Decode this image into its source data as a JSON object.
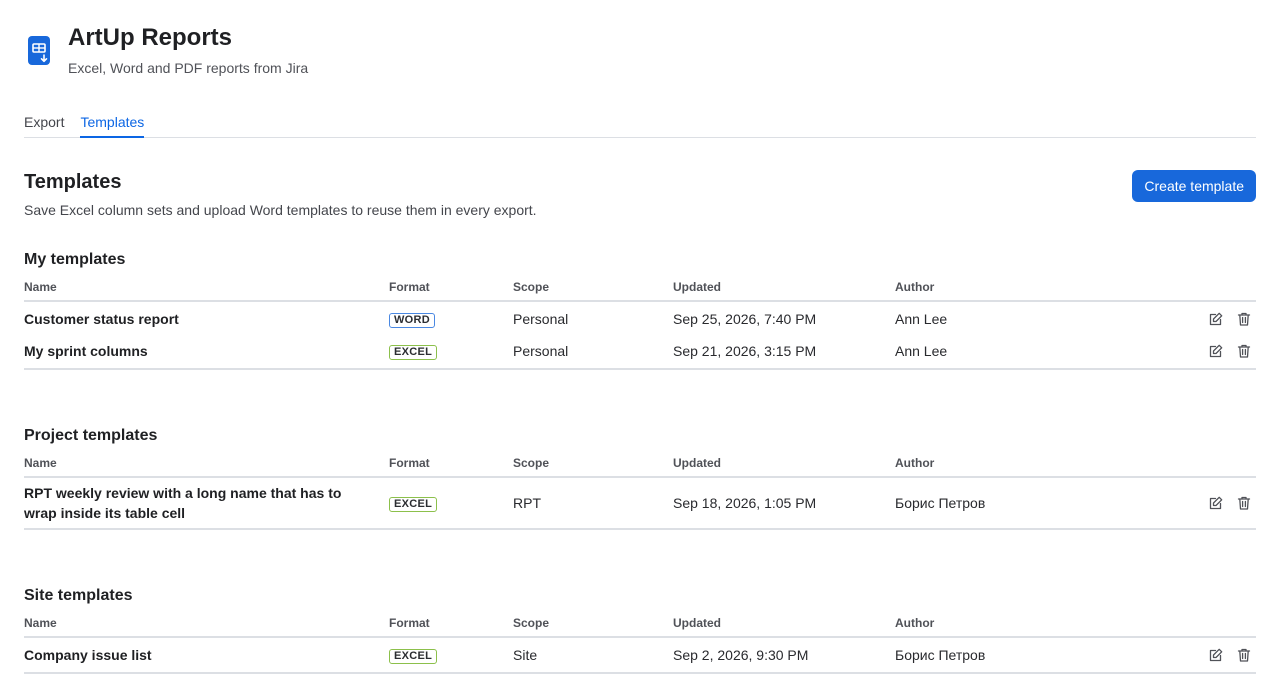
{
  "app": {
    "title": "ArtUp Reports",
    "subtitle": "Excel, Word and PDF reports from Jira",
    "logo_icon": "spreadsheet-download-icon",
    "logo_color": "#1868db"
  },
  "tabs": [
    {
      "label": "Export",
      "active": false
    },
    {
      "label": "Templates",
      "active": true
    }
  ],
  "page": {
    "title": "Templates",
    "description": "Save Excel column sets and upload Word templates to reuse them in every export.",
    "create_button": "Create template"
  },
  "columns": {
    "name": "Name",
    "format": "Format",
    "scope": "Scope",
    "updated": "Updated",
    "author": "Author"
  },
  "groups": [
    {
      "title": "My templates",
      "rows": [
        {
          "name": "Customer status report",
          "format": "WORD",
          "scope": "Personal",
          "updated": "Sep 25, 2026, 7:40 PM",
          "author": "Ann Lee"
        },
        {
          "name": "My sprint columns",
          "format": "EXCEL",
          "scope": "Personal",
          "updated": "Sep 21, 2026, 3:15 PM",
          "author": "Ann Lee"
        }
      ]
    },
    {
      "title": "Project templates",
      "rows": [
        {
          "name": "RPT weekly review with a long name that has to wrap inside its table cell",
          "format": "EXCEL",
          "scope": "RPT",
          "updated": "Sep 18, 2026, 1:05 PM",
          "author": "Борис Петров"
        }
      ]
    },
    {
      "title": "Site templates",
      "rows": [
        {
          "name": "Company issue list",
          "format": "EXCEL",
          "scope": "Site",
          "updated": "Sep 2, 2026, 9:30 PM",
          "author": "Борис Петров"
        }
      ]
    }
  ],
  "colors": {
    "accent": "#0c66e4",
    "primary_button": "#1868db",
    "word_badge_border": "#4a88e2",
    "excel_badge_border": "#8cc04b"
  },
  "row_action_icons": [
    "edit-icon",
    "trash-icon"
  ]
}
